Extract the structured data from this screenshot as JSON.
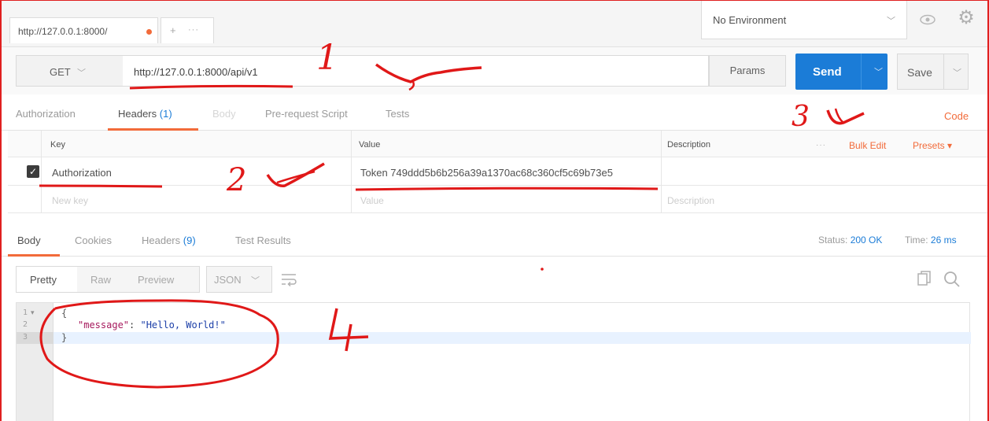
{
  "tab": {
    "title": "http://127.0.0.1:8000/",
    "unsaved_color": "#f26b3a",
    "add_label": "+",
    "more_label": "···"
  },
  "environment": {
    "selected": "No Environment"
  },
  "request": {
    "method": "GET",
    "url": "http://127.0.0.1:8000/api/v1",
    "params_label": "Params",
    "send_label": "Send",
    "save_label": "Save"
  },
  "request_tabs": {
    "items": [
      {
        "label": "Authorization"
      },
      {
        "label": "Headers",
        "count": "(1)"
      },
      {
        "label": "Body"
      },
      {
        "label": "Pre-request Script"
      },
      {
        "label": "Tests"
      }
    ],
    "code_link": "Code"
  },
  "headers_table": {
    "columns": {
      "key": "Key",
      "value": "Value",
      "description": "Description"
    },
    "more_label": "···",
    "bulk_edit": "Bulk Edit",
    "presets": "Presets ▾",
    "rows": [
      {
        "key": "Authorization",
        "value": "Token 749ddd5b6b256a39a1370ac68c360cf5c69b73e5",
        "checked": true
      }
    ],
    "placeholder": {
      "key": "New key",
      "value": "Value",
      "description": "Description"
    }
  },
  "response_tabs": {
    "items": [
      {
        "label": "Body"
      },
      {
        "label": "Cookies"
      },
      {
        "label": "Headers",
        "count": "(9)"
      },
      {
        "label": "Test Results"
      }
    ],
    "status_label": "Status:",
    "status_value": "200 OK",
    "time_label": "Time:",
    "time_value": "26 ms"
  },
  "response_toolbar": {
    "view_modes": [
      "Pretty",
      "Raw",
      "Preview"
    ],
    "format": "JSON"
  },
  "response_body": {
    "line_numbers": [
      "1",
      "2",
      "3"
    ],
    "open_brace": "{",
    "key": "\"message\"",
    "colon": ": ",
    "value": "\"Hello, World!\"",
    "close_brace": "}"
  },
  "annotations": {
    "labels": [
      "1",
      "2",
      "3",
      "4"
    ],
    "color": "#e01818"
  },
  "icons": [
    "eye-icon",
    "gear-icon",
    "wrap-icon",
    "copy-icon",
    "search-icon",
    "chevron-down-icon",
    "check-icon"
  ]
}
